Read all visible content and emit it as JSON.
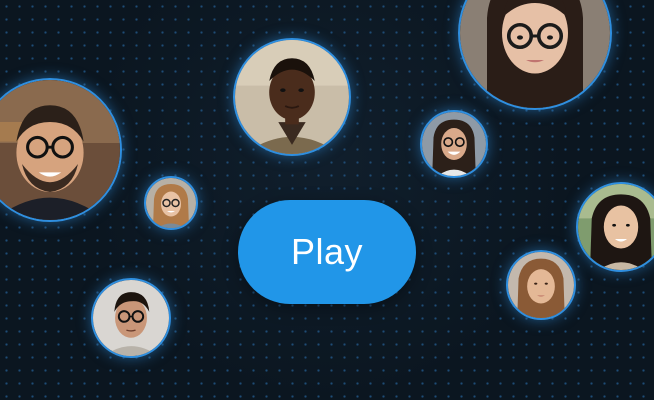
{
  "play_label": "Play",
  "colors": {
    "background": "#0b1620",
    "dot_grid": "#2d78be",
    "avatar_ring": "#2f8fe0",
    "play_button": "#2196e8",
    "play_text": "#ffffff"
  },
  "avatars": [
    {
      "id": "avatar-man-glasses-left"
    },
    {
      "id": "avatar-man-center-top"
    },
    {
      "id": "avatar-woman-glasses-top-right"
    },
    {
      "id": "avatar-woman-glasses-small-left"
    },
    {
      "id": "avatar-man-glasses-bottom-left"
    },
    {
      "id": "avatar-woman-glasses-small-center"
    },
    {
      "id": "avatar-woman-right"
    },
    {
      "id": "avatar-woman-bottom-right"
    }
  ]
}
